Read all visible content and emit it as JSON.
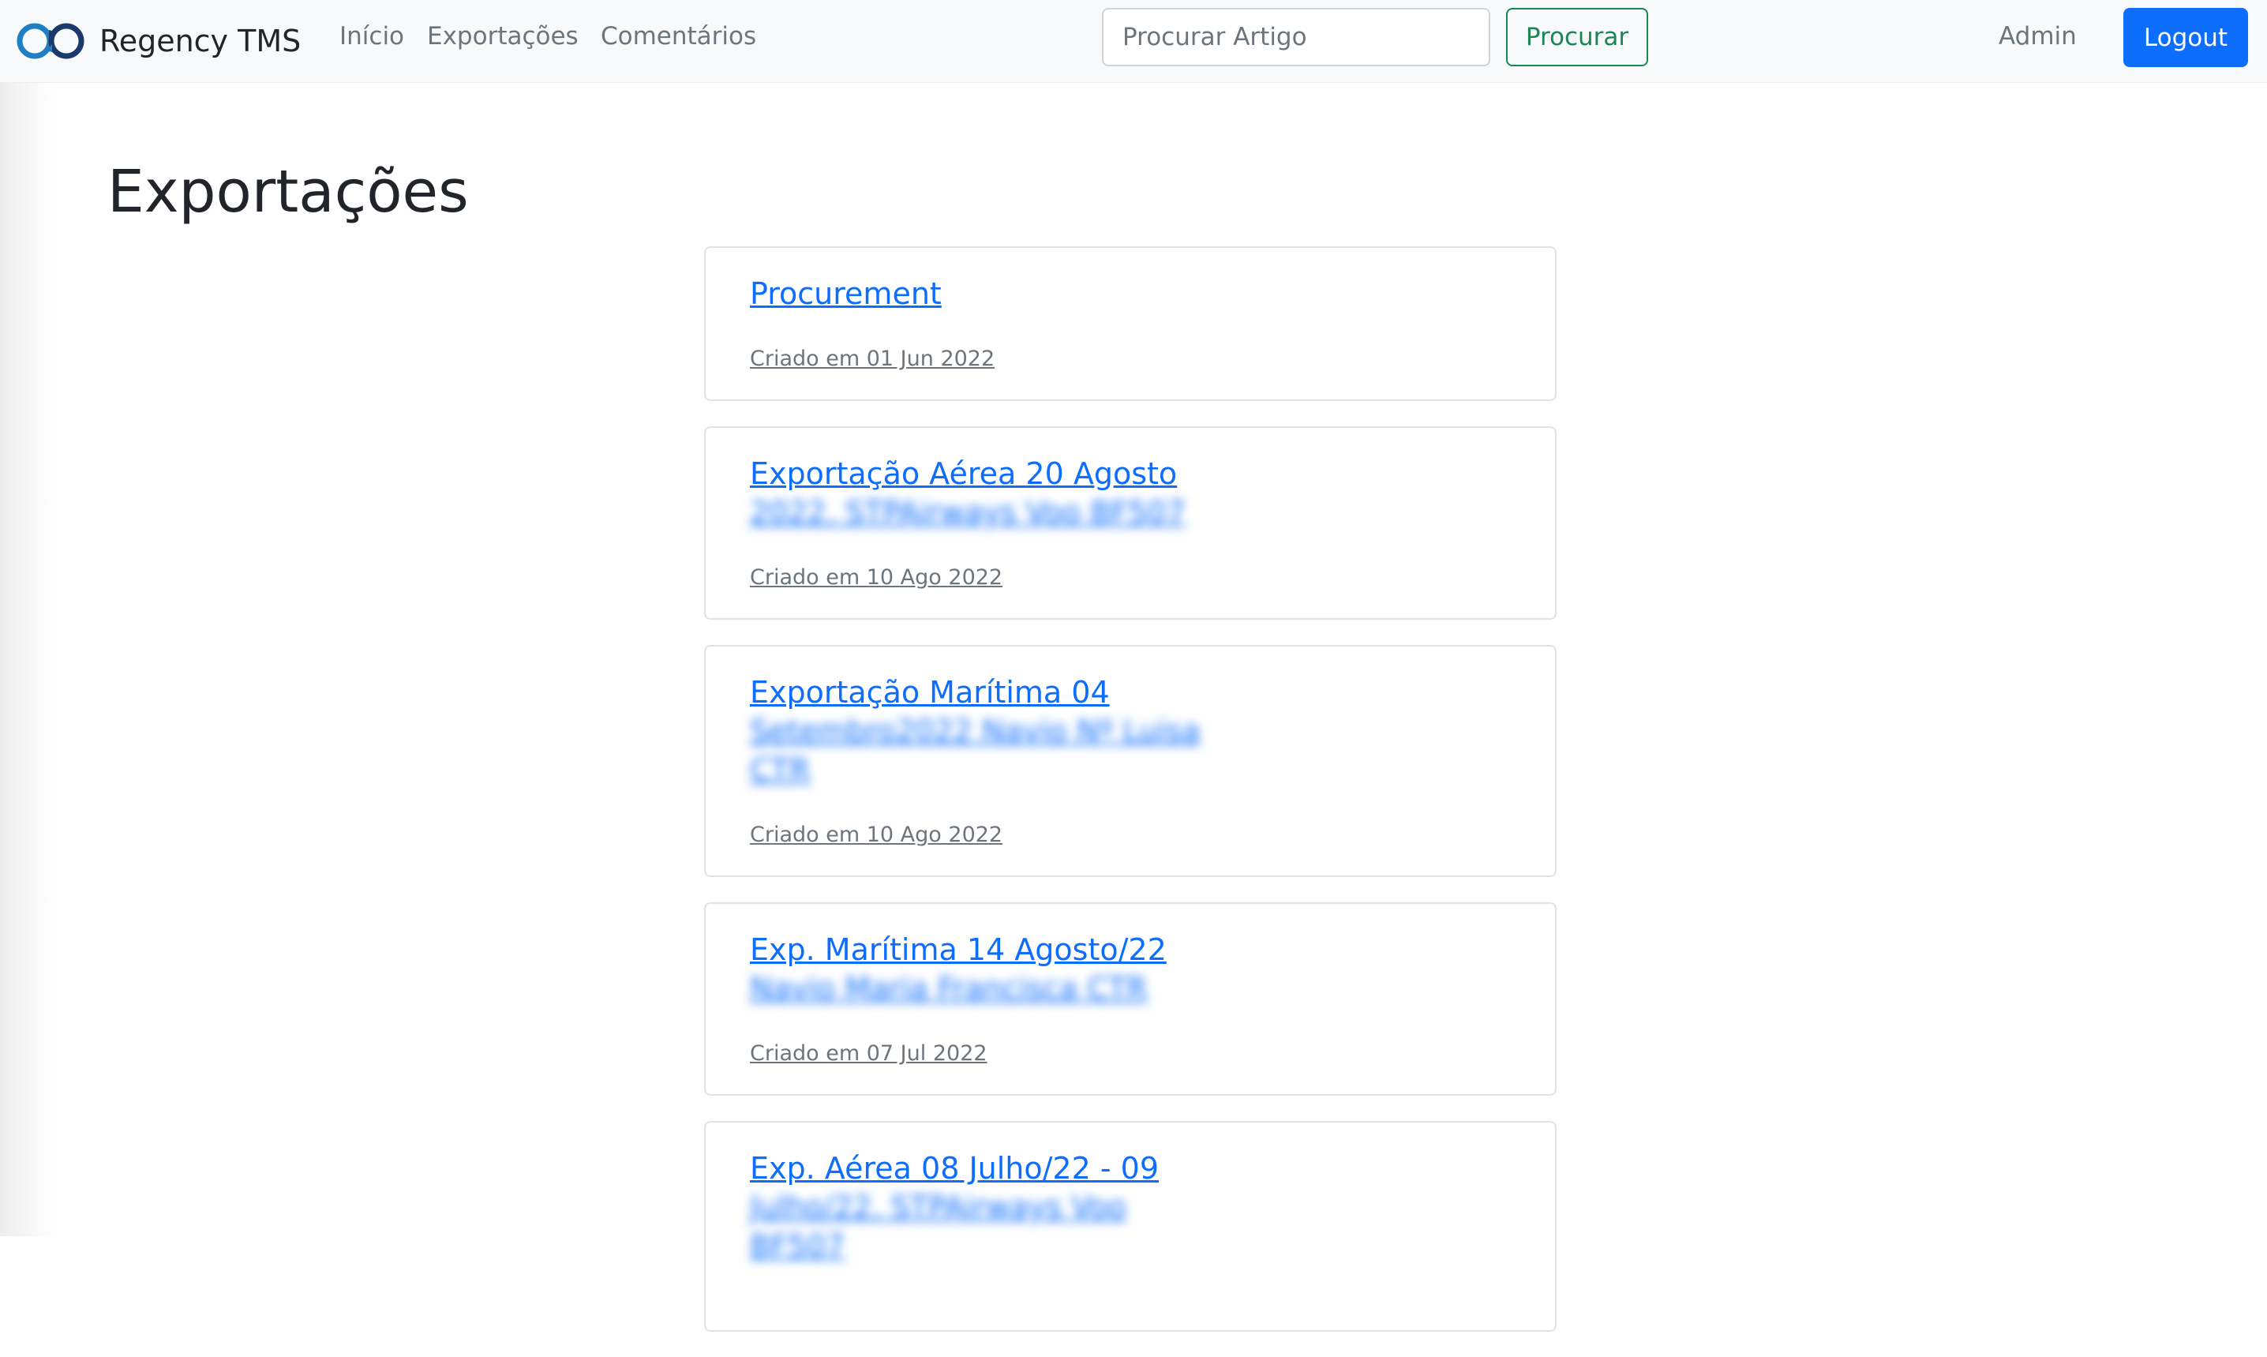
{
  "navbar": {
    "brand": "Regency TMS",
    "links": [
      "Início",
      "Exportações",
      "Comentários"
    ],
    "search_placeholder": "Procurar Artigo",
    "search_button": "Procurar",
    "user": "Admin",
    "logout": "Logout"
  },
  "page": {
    "title": "Exportações"
  },
  "exports": [
    {
      "title": "Procurement",
      "blurred": [],
      "date": "Criado em 01 Jun 2022"
    },
    {
      "title": "Exportação Aérea 20 Agosto",
      "blurred": [
        "2022. STPAirways Voo BF507"
      ],
      "date": "Criado em 10 Ago 2022"
    },
    {
      "title": "Exportação Marítima 04",
      "blurred": [
        "Setembro2022 Navio Nº Luisa",
        "CTR"
      ],
      "date": "Criado em 10 Ago 2022"
    },
    {
      "title": "Exp. Marítima 14 Agosto/22",
      "blurred": [
        "Navio Maria Francisca CTR"
      ],
      "date": "Criado em 07 Jul 2022"
    },
    {
      "title": "Exp. Aérea 08 Julho/22 - 09",
      "blurred": [
        "Julho/22. STPAirways Voo BF507"
      ],
      "date": ""
    }
  ]
}
